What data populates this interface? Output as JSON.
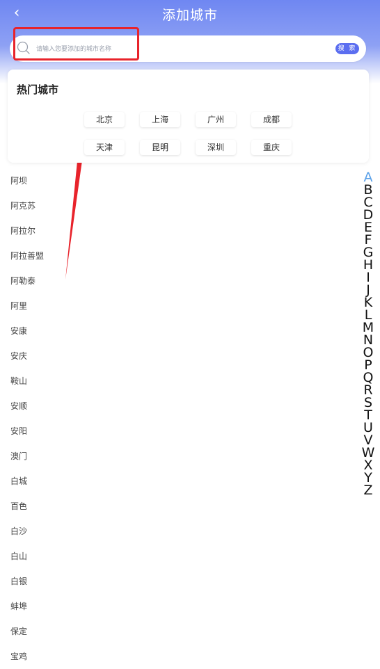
{
  "header": {
    "back_glyph": "‹",
    "title": "添加城市"
  },
  "search": {
    "placeholder": "请输入您要添加的城市名称",
    "button_label": "搜 索"
  },
  "hot_cities": {
    "title": "热门城市",
    "items": [
      "北京",
      "上海",
      "广州",
      "成都",
      "天津",
      "昆明",
      "深圳",
      "重庆"
    ]
  },
  "cities": [
    "阿坝",
    "阿克苏",
    "阿拉尔",
    "阿拉善盟",
    "阿勒泰",
    "阿里",
    "安康",
    "安庆",
    "鞍山",
    "安顺",
    "安阳",
    "澳门",
    "白城",
    "百色",
    "白沙",
    "白山",
    "白银",
    "蚌埠",
    "保定",
    "宝鸡"
  ],
  "alpha_index": {
    "letters": [
      "A",
      "B",
      "C",
      "D",
      "E",
      "F",
      "G",
      "H",
      "I",
      "J",
      "K",
      "L",
      "M",
      "N",
      "O",
      "P",
      "Q",
      "R",
      "S",
      "T",
      "U",
      "V",
      "W",
      "X",
      "Y",
      "Z"
    ],
    "active": "A"
  },
  "colors": {
    "header": "#6f87f2",
    "search_button": "#5b6ef0",
    "highlight": "#e8232b",
    "active_letter": "#5aa0e8"
  }
}
